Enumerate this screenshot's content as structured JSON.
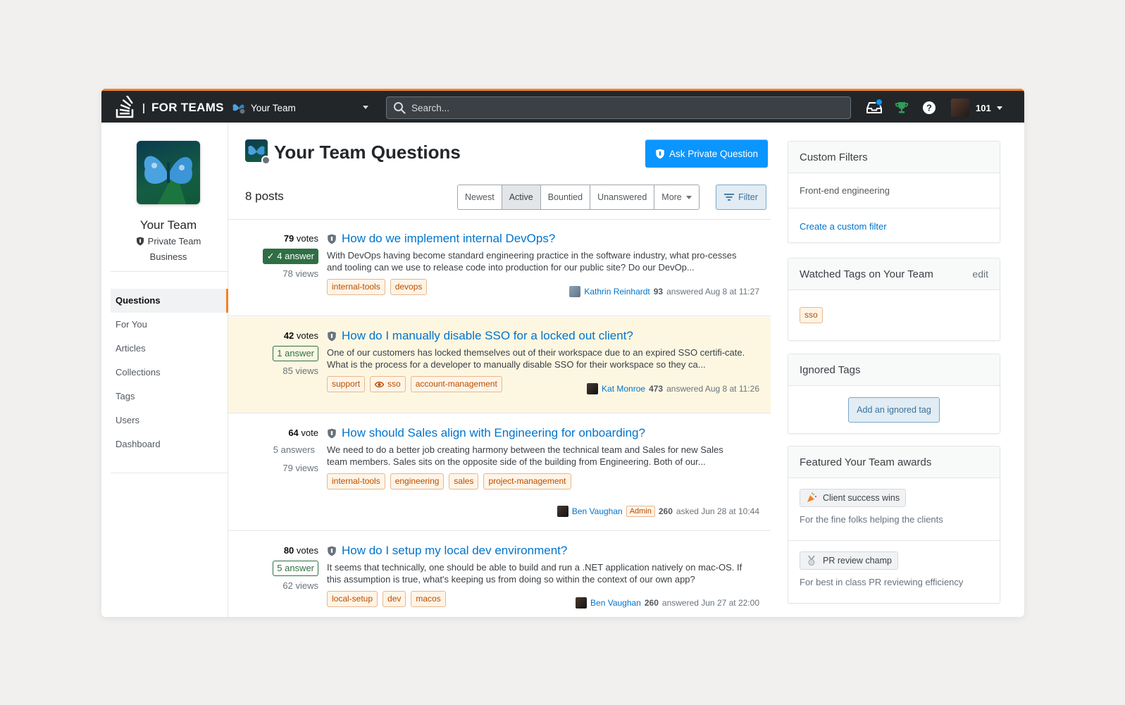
{
  "header": {
    "brand": "FOR TEAMS",
    "team_name": "Your Team",
    "search_placeholder": "Search...",
    "reputation": "101"
  },
  "sidebar": {
    "team_title": "Your Team",
    "team_type": "Private Team",
    "team_plan": "Business",
    "nav": [
      {
        "label": "Questions",
        "active": true
      },
      {
        "label": "For You"
      },
      {
        "label": "Articles"
      },
      {
        "label": "Collections"
      },
      {
        "label": "Tags"
      },
      {
        "label": "Users"
      },
      {
        "label": "Dashboard"
      }
    ]
  },
  "main": {
    "title": "Your Team Questions",
    "ask_button": "Ask Private Question",
    "post_count": "8 posts",
    "sort_tabs": [
      "Newest",
      "Active",
      "Bountied",
      "Unanswered",
      "More"
    ],
    "sort_selected": "Active",
    "filter_button": "Filter",
    "questions": [
      {
        "votes": "79",
        "votes_label": "votes",
        "answers": "4 answer",
        "answer_state": "accepted",
        "views": "78 views",
        "title": "How do we implement internal DevOps?",
        "excerpt": "With DevOps having become standard engineering practice in the software industry, what pro-cesses and tooling can we use to release code into production for our public site? Do our DevOp...",
        "tags": [
          "internal-tools",
          "devops"
        ],
        "user": "Kathrin Reinhardt",
        "rep": "93",
        "badge": "",
        "action": "answered Aug 8 at 11:27"
      },
      {
        "votes": "42",
        "votes_label": "votes",
        "answers": "1 answer",
        "answer_state": "answered",
        "views": "85 views",
        "title": "How do I manually disable SSO for a locked out client?",
        "excerpt": "One of our customers has locked themselves out of their workspace due to an expired SSO certifi-cate. What is the process for a developer to manually disable SSO for their workspace so they ca...",
        "tags": [
          "support",
          "sso",
          "account-management"
        ],
        "user": "Kat Monroe",
        "rep": "473",
        "badge": "",
        "action": "answered Aug 8 at 11:26"
      },
      {
        "votes": "64",
        "votes_label": "vote",
        "answers": "5 answers",
        "answer_state": "plain",
        "views": "79 views",
        "title": "How should Sales align with Engineering for onboarding?",
        "excerpt": "We need to do a better job creating harmony between the technical team and Sales for new Sales team members. Sales sits on the opposite side of the building from Engineering. Both of our...",
        "tags": [
          "internal-tools",
          "engineering",
          "sales",
          "project-management"
        ],
        "user": "Ben Vaughan",
        "rep": "260",
        "badge": "Admin",
        "action": "asked Jun 28 at 10:44"
      },
      {
        "votes": "80",
        "votes_label": "votes",
        "answers": "5 answer",
        "answer_state": "answered",
        "views": "62 views",
        "title": "How do I setup my local dev environment?",
        "excerpt": "It seems that technically, one should be able to build and run a .NET application natively on mac-OS. If this assumption is true, what's keeping us from doing so within the context of our own app?",
        "tags": [
          "local-setup",
          "dev",
          "macos"
        ],
        "user": "Ben Vaughan",
        "rep": "260",
        "badge": "",
        "action": "answered Jun 27 at 22:00"
      }
    ]
  },
  "right": {
    "custom_filters": {
      "title": "Custom Filters",
      "filter": "Front-end engineering",
      "create_link": "Create a custom filter"
    },
    "watched_tags": {
      "title": "Watched Tags on Your Team",
      "edit": "edit",
      "tags": [
        "sso"
      ]
    },
    "ignored_tags": {
      "title": "Ignored Tags",
      "button": "Add an ignored tag"
    },
    "awards": {
      "title": "Featured Your Team awards",
      "items": [
        {
          "name": "Client success wins",
          "desc": "For the fine folks helping the clients"
        },
        {
          "name": "PR review champ",
          "desc": "For best in class PR reviewing efficiency"
        }
      ]
    }
  },
  "colors": {
    "accent": "#f48225",
    "primary_blue": "#0a95ff",
    "link": "#0074cc",
    "tag_text": "#b84e00",
    "accepted_green": "#2f6f44",
    "highlight_row": "#fdf7e2"
  }
}
